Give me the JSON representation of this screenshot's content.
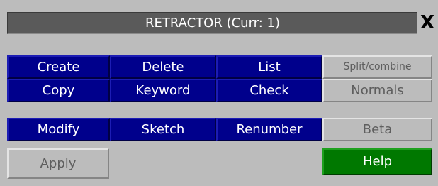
{
  "window": {
    "title": "RETRACTOR (Curr: 1)",
    "close_label": "X"
  },
  "buttons": {
    "create": "Create",
    "delete": "Delete",
    "list": "List",
    "split_combine": "Split/combine",
    "copy": "Copy",
    "keyword": "Keyword",
    "check": "Check",
    "normals": "Normals",
    "modify": "Modify",
    "sketch": "Sketch",
    "renumber": "Renumber",
    "beta": "Beta",
    "apply": "Apply",
    "help": "Help"
  },
  "colors": {
    "panel_background": "#bcbcbc",
    "title_background": "#5a5a5a",
    "action_button": "#00008c",
    "help_button": "#007800",
    "disabled_text": "#5e5e5e"
  }
}
